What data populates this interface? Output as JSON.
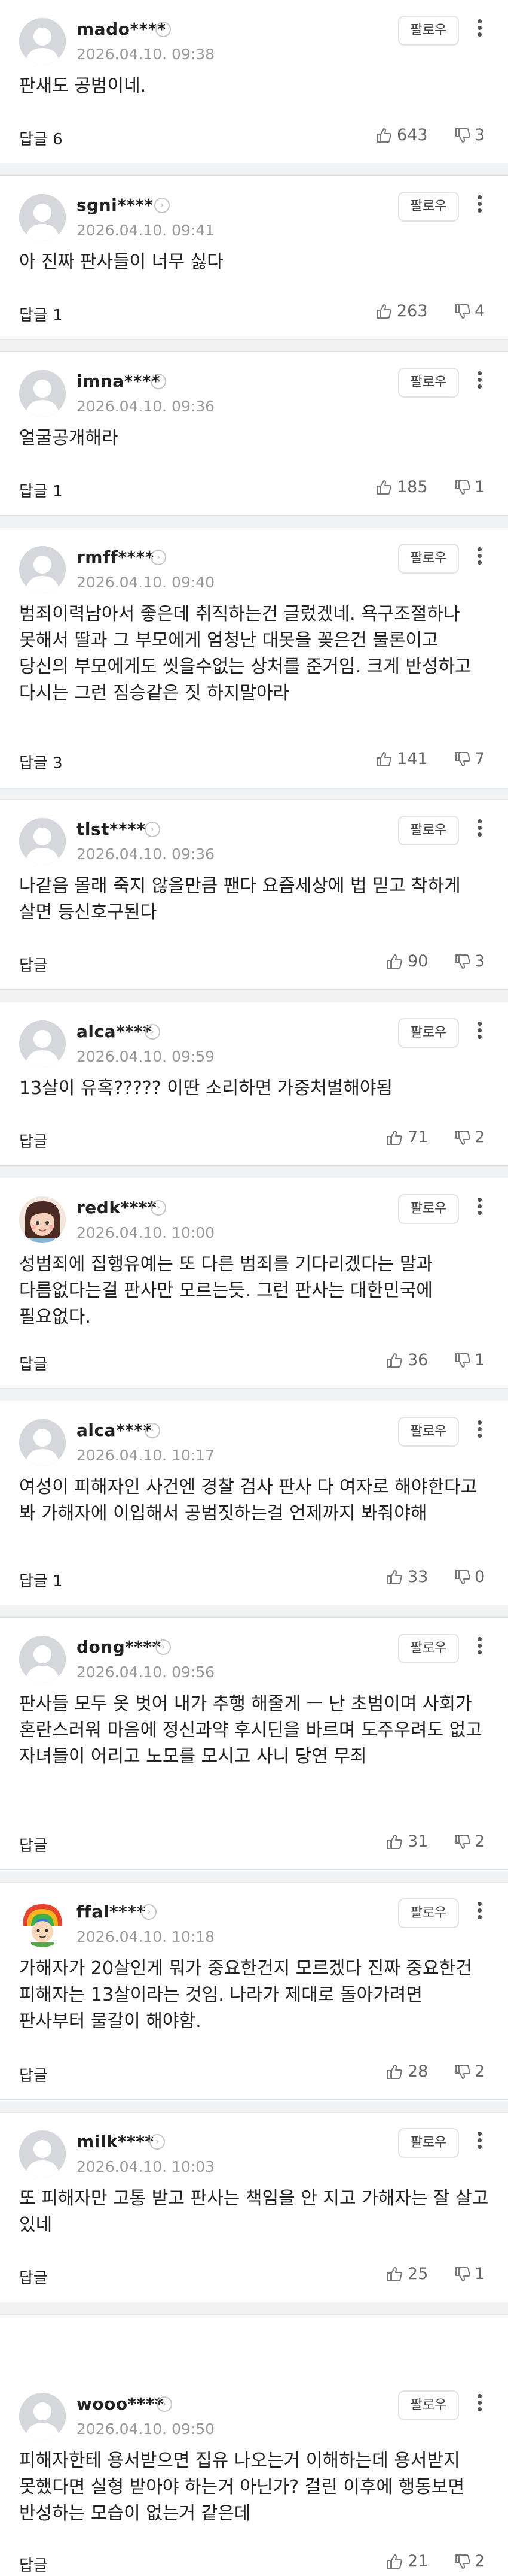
{
  "follow_label": "팔로우",
  "reply_label": "답글",
  "comments": [
    {
      "user": "mado****",
      "date": "2026.04.10. 09:38",
      "body": "판새도 공범이네.",
      "reply_count": "6",
      "likes": "643",
      "dislikes": "3",
      "avatar": "default"
    },
    {
      "user": "sgni****",
      "date": "2026.04.10. 09:41",
      "body": "아 진짜 판사들이 너무 싫다",
      "reply_count": "1",
      "likes": "263",
      "dislikes": "4",
      "avatar": "default"
    },
    {
      "user": "imna****",
      "date": "2026.04.10. 09:36",
      "body": "얼굴공개해라",
      "reply_count": "1",
      "likes": "185",
      "dislikes": "1",
      "avatar": "default"
    },
    {
      "user": "rmff****",
      "date": "2026.04.10. 09:40",
      "body": "범죄이력남아서 좋은데 취직하는건 글렀겠네. 욕구조절하나 못해서 딸과 그 부모에게 엄청난 대못을 꽂은건 물론이고 당신의 부모에게도 씻을수없는 상처를 준거임. 크게 반성하고 다시는 그런 짐승같은 짓 하지말아라",
      "reply_count": "3",
      "likes": "141",
      "dislikes": "7",
      "avatar": "default"
    },
    {
      "user": "tlst****",
      "date": "2026.04.10. 09:36",
      "body": "나같음 몰래 죽지 않을만큼 팬다 요즘세상에 법 믿고 착하게 살면 등신호구된다",
      "reply_count": "",
      "likes": "90",
      "dislikes": "3",
      "avatar": "default"
    },
    {
      "user": "alca****",
      "date": "2026.04.10. 09:59",
      "body": "13살이 유혹????? 이딴 소리하면 가중처벌해야됨",
      "reply_count": "",
      "likes": "71",
      "dislikes": "2",
      "avatar": "default"
    },
    {
      "user": "redk****",
      "date": "2026.04.10. 10:00",
      "body": "성범죄에 집행유예는 또 다른 범죄를 기다리겠다는 말과 다름없다는걸 판사만 모르는듯. 그런 판사는 대한민국에 필요없다.",
      "reply_count": "",
      "likes": "36",
      "dislikes": "1",
      "avatar": "girl"
    },
    {
      "user": "alca****",
      "date": "2026.04.10. 10:17",
      "body": "여성이 피해자인 사건엔 경찰 검사 판사 다 여자로 해야한다고 봐 가해자에 이입해서 공범짓하는걸 언제까지 봐줘야해",
      "reply_count": "1",
      "likes": "33",
      "dislikes": "0",
      "avatar": "default"
    },
    {
      "user": "dong****",
      "date": "2026.04.10. 09:56",
      "body": "판사들 모두 옷 벗어 내가 추행 해줄게 ㅡ 난 초범이며 사회가 혼란스러워 마음에 정신과약 후시딘을 바르며 도주우려도 없고 자녀들이 어리고 노모를 모시고 사니 당연 무죄",
      "reply_count": "",
      "likes": "31",
      "dislikes": "2",
      "avatar": "default"
    },
    {
      "user": "ffal****",
      "date": "2026.04.10. 10:18",
      "body": "가해자가 20살인게 뭐가 중요한건지 모르겠다 진짜 중요한건 피해자는 13살이라는 것임. 나라가 제대로 돌아가려면 판사부터 물갈이 해야함.",
      "reply_count": "",
      "likes": "28",
      "dislikes": "2",
      "avatar": "rainbow"
    },
    {
      "user": "milk****",
      "date": "2026.04.10. 10:03",
      "body": "또 피해자만 고통 받고 판사는 책임을 안 지고 가해자는 잘 살고 있네",
      "reply_count": "",
      "likes": "25",
      "dislikes": "1",
      "avatar": "default"
    },
    {
      "user": "wooo****",
      "date": "2026.04.10. 09:50",
      "body": "피해자한테 용서받으면 집유 나오는거 이해하는데 용서받지 못했다면 실형 받아야 하는거 아닌가? 걸린 이후에 행동보면 반성하는 모습이 없는거 같은데",
      "reply_count": "",
      "likes": "21",
      "dislikes": "2",
      "avatar": "default"
    }
  ]
}
